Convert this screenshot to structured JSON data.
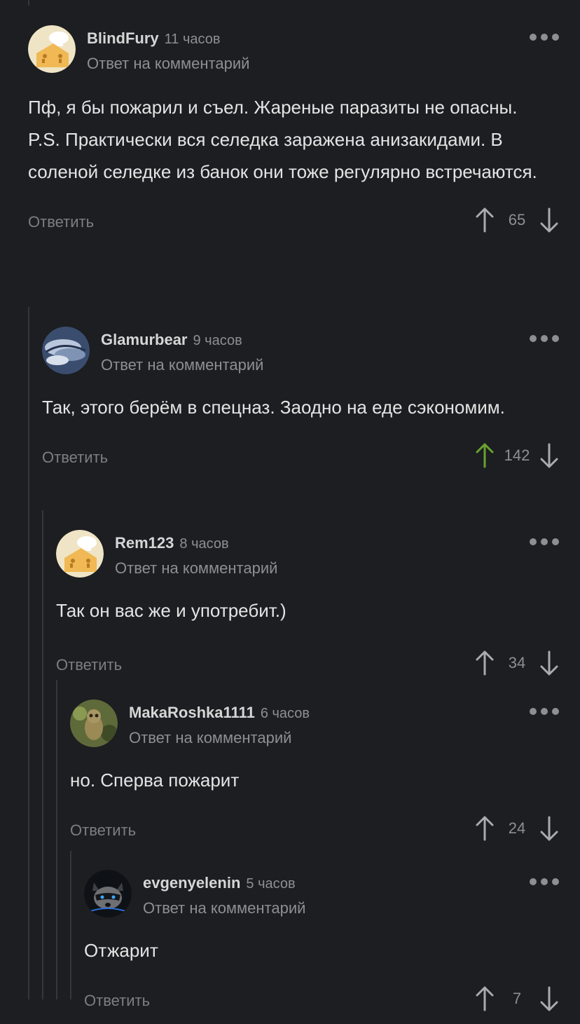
{
  "colors": {
    "background": "#1c1e21",
    "text": "#e4e4e4",
    "muted": "#8d8f93",
    "upvoted": "#6aa22f",
    "thread_line": "#34373b"
  },
  "comments": [
    {
      "username": "BlindFury",
      "time": "11 часов",
      "reply_to": "Ответ на комментарий",
      "text": "Пф, я бы пожарил и съел. Жареные паразиты не опасны.\nP.S. Практически вся селедка заражена анизакидами. В соленой селедке из банок они тоже регулярно встречаются.",
      "reply_label": "Ответить",
      "votes": "65",
      "avatar_icon": "default-avatar-icon"
    },
    {
      "username": "Glamurbear",
      "time": "9 часов",
      "reply_to": "Ответ на комментарий",
      "text": "Так, этого берём в спецназ. Заодно на еде сэкономим.",
      "reply_label": "Ответить",
      "votes": "142",
      "upvoted": true,
      "avatar_icon": "ice-landscape-avatar"
    },
    {
      "username": "Rem123",
      "time": "8 часов",
      "reply_to": "Ответ на комментарий",
      "text": "Так он вас же и употребит.)",
      "reply_label": "Ответить",
      "votes": "34",
      "avatar_icon": "default-avatar-icon"
    },
    {
      "username": "MakaRoshka1111",
      "time": "6 часов",
      "reply_to": "Ответ на комментарий",
      "text": "но. Сперва пожарит",
      "reply_label": "Ответить",
      "votes": "24",
      "avatar_icon": "owl-avatar"
    },
    {
      "username": "evgenyelenin",
      "time": "5 часов",
      "reply_to": "Ответ на комментарий",
      "text": "Отжарит",
      "reply_label": "Ответить",
      "votes": "7",
      "avatar_icon": "raccoon-avatar"
    }
  ]
}
